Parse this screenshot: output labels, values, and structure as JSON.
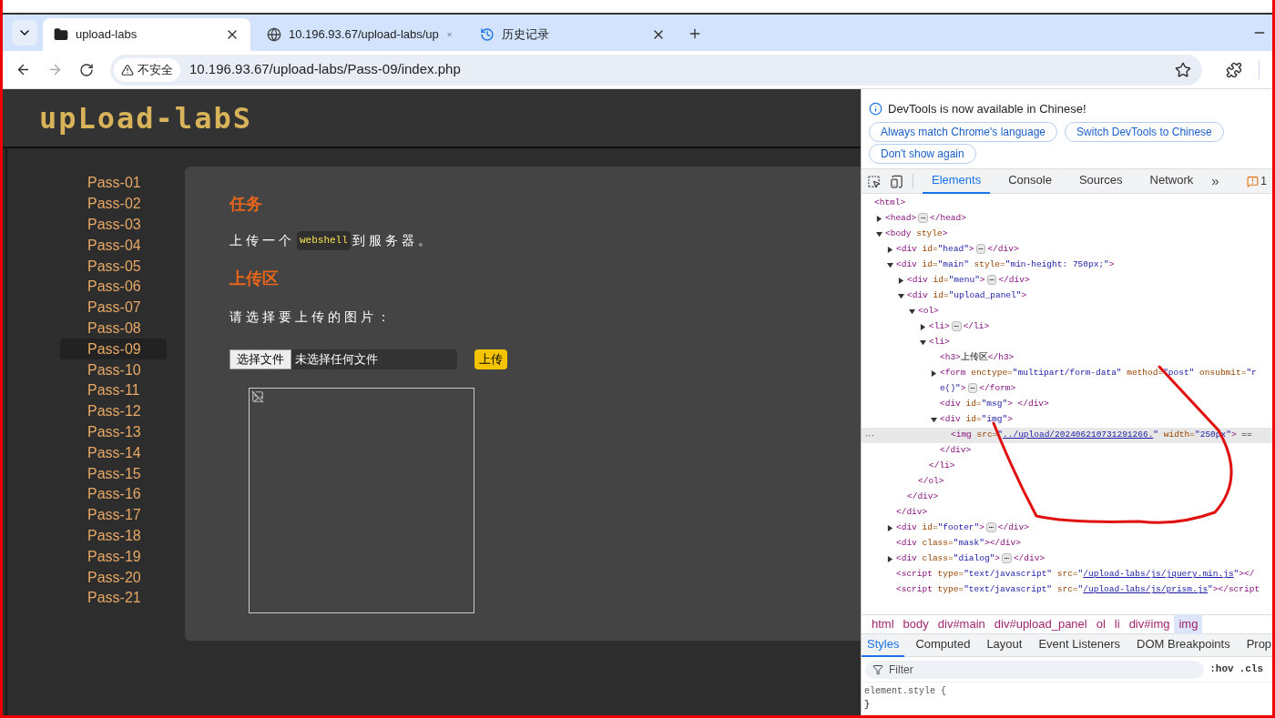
{
  "browser": {
    "tabs": [
      {
        "title": "upload-labs",
        "selected": true
      },
      {
        "title": "10.196.93.67/upload-labs/up",
        "selected": false
      },
      {
        "title": "历史记录",
        "selected": false
      }
    ],
    "security_label": "不安全",
    "url": "10.196.93.67/upload-labs/Pass-09/index.php"
  },
  "page": {
    "logo": "upLoad-labS",
    "menu": [
      {
        "label": "Pass-01",
        "selected": false
      },
      {
        "label": "Pass-02",
        "selected": false
      },
      {
        "label": "Pass-03",
        "selected": false
      },
      {
        "label": "Pass-04",
        "selected": false
      },
      {
        "label": "Pass-05",
        "selected": false
      },
      {
        "label": "Pass-06",
        "selected": false
      },
      {
        "label": "Pass-07",
        "selected": false
      },
      {
        "label": "Pass-08",
        "selected": false
      },
      {
        "label": "Pass-09",
        "selected": true
      },
      {
        "label": "Pass-10",
        "selected": false
      },
      {
        "label": "Pass-11",
        "selected": false
      },
      {
        "label": "Pass-12",
        "selected": false
      },
      {
        "label": "Pass-13",
        "selected": false
      },
      {
        "label": "Pass-14",
        "selected": false
      },
      {
        "label": "Pass-15",
        "selected": false
      },
      {
        "label": "Pass-16",
        "selected": false
      },
      {
        "label": "Pass-17",
        "selected": false
      },
      {
        "label": "Pass-18",
        "selected": false
      },
      {
        "label": "Pass-19",
        "selected": false
      },
      {
        "label": "Pass-20",
        "selected": false
      },
      {
        "label": "Pass-21",
        "selected": false
      }
    ],
    "task_heading": "任务",
    "task_text": [
      {
        "kind": "text",
        "text": "上传一个"
      },
      {
        "kind": "code",
        "text": "webshell"
      },
      {
        "kind": "text",
        "text": "到服务器。"
      }
    ],
    "upload_heading": "上传区",
    "prompt": "请选择要上传的图片：",
    "choose_button": "选择文件",
    "file_status": "未选择任何文件",
    "upload_button": "上传"
  },
  "devtools": {
    "notice": "DevTools is now available in Chinese!",
    "notice_buttons": [
      "Always match Chrome's language",
      "Switch DevTools to Chinese",
      "Don't show again"
    ],
    "tabs": [
      {
        "label": "Elements",
        "selected": true
      },
      {
        "label": "Console",
        "selected": false
      },
      {
        "label": "Sources",
        "selected": false
      },
      {
        "label": "Network",
        "selected": false
      }
    ],
    "more": "»",
    "issues_count": "1",
    "selected_line_marker": "···",
    "tree": [
      {
        "kind": "plain",
        "selected": false,
        "parts": [
          {
            "kind": "tag",
            "text": "<html>"
          }
        ],
        "children": [
          {
            "kind": "expandable",
            "expanded": false,
            "selected": false,
            "parts": [
              {
                "kind": "tag",
                "text": "<head>"
              },
              {
                "kind": "more",
                "text": "⋯"
              },
              {
                "kind": "tag",
                "text": "</head>"
              }
            ]
          },
          {
            "kind": "expandable",
            "expanded": true,
            "selected": false,
            "parts": [
              {
                "kind": "tag",
                "text": "<body"
              },
              {
                "kind": "attr",
                "text": " style"
              },
              {
                "kind": "tag",
                "text": ">"
              }
            ],
            "children": [
              {
                "kind": "expandable",
                "expanded": false,
                "selected": false,
                "parts": [
                  {
                    "kind": "tag",
                    "text": "<div"
                  },
                  {
                    "kind": "attr",
                    "text": " id="
                  },
                  {
                    "kind": "value",
                    "text": "\"head\""
                  },
                  {
                    "kind": "tag",
                    "text": ">"
                  },
                  {
                    "kind": "more",
                    "text": "⋯"
                  },
                  {
                    "kind": "tag",
                    "text": "</div>"
                  }
                ]
              },
              {
                "kind": "expandable",
                "expanded": true,
                "selected": false,
                "parts": [
                  {
                    "kind": "tag",
                    "text": "<div"
                  },
                  {
                    "kind": "attr",
                    "text": " id="
                  },
                  {
                    "kind": "value",
                    "text": "\"main\""
                  },
                  {
                    "kind": "attr",
                    "text": " style="
                  },
                  {
                    "kind": "value",
                    "text": "\"min-height: 750px;\""
                  },
                  {
                    "kind": "tag",
                    "text": ">"
                  }
                ],
                "closing": "</div>",
                "children": [
                  {
                    "kind": "expandable",
                    "expanded": false,
                    "selected": false,
                    "parts": [
                      {
                        "kind": "tag",
                        "text": "<div"
                      },
                      {
                        "kind": "attr",
                        "text": " id="
                      },
                      {
                        "kind": "value",
                        "text": "\"menu\""
                      },
                      {
                        "kind": "tag",
                        "text": ">"
                      },
                      {
                        "kind": "more",
                        "text": "⋯"
                      },
                      {
                        "kind": "tag",
                        "text": "</div>"
                      }
                    ]
                  },
                  {
                    "kind": "expandable",
                    "expanded": true,
                    "selected": false,
                    "parts": [
                      {
                        "kind": "tag",
                        "text": "<div"
                      },
                      {
                        "kind": "attr",
                        "text": " id="
                      },
                      {
                        "kind": "value",
                        "text": "\"upload_panel\""
                      },
                      {
                        "kind": "tag",
                        "text": ">"
                      }
                    ],
                    "closing": "</div>",
                    "children": [
                      {
                        "kind": "expandable",
                        "expanded": true,
                        "selected": false,
                        "parts": [
                          {
                            "kind": "tag",
                            "text": "<ol>"
                          }
                        ],
                        "closing": "</ol>",
                        "children": [
                          {
                            "kind": "expandable",
                            "expanded": false,
                            "selected": false,
                            "parts": [
                              {
                                "kind": "tag",
                                "text": "<li>"
                              },
                              {
                                "kind": "more",
                                "text": "⋯"
                              },
                              {
                                "kind": "tag",
                                "text": "</li>"
                              }
                            ]
                          },
                          {
                            "kind": "expandable",
                            "expanded": true,
                            "selected": false,
                            "parts": [
                              {
                                "kind": "tag",
                                "text": "<li>"
                              }
                            ],
                            "closing": "</li>",
                            "children": [
                              {
                                "kind": "plain",
                                "selected": false,
                                "parts": [
                                  {
                                    "kind": "tag",
                                    "text": "<h3>"
                                  },
                                  {
                                    "kind": "text",
                                    "text": "上传区"
                                  },
                                  {
                                    "kind": "tag",
                                    "text": "</h3>"
                                  }
                                ]
                              },
                              {
                                "kind": "expandable",
                                "expanded": false,
                                "selected": false,
                                "parts": [
                                  {
                                    "kind": "tag",
                                    "text": "<form"
                                  },
                                  {
                                    "kind": "attr",
                                    "text": " enctype="
                                  },
                                  {
                                    "kind": "value",
                                    "text": "\"multipart/form-data\""
                                  },
                                  {
                                    "kind": "attr",
                                    "text": " method="
                                  },
                                  {
                                    "kind": "value",
                                    "text": "\"post\""
                                  },
                                  {
                                    "kind": "attr",
                                    "text": " onsubmit="
                                  },
                                  {
                                    "kind": "value",
                                    "text": "\"r"
                                  }
                                ],
                                "wrap_parts": [
                                  {
                                    "kind": "value",
                                    "text": "e()\""
                                  },
                                  {
                                    "kind": "tag",
                                    "text": ">"
                                  },
                                  {
                                    "kind": "more",
                                    "text": "⋯"
                                  },
                                  {
                                    "kind": "tag",
                                    "text": "</form>"
                                  }
                                ]
                              },
                              {
                                "kind": "plain",
                                "selected": false,
                                "parts": [
                                  {
                                    "kind": "tag",
                                    "text": "<div"
                                  },
                                  {
                                    "kind": "attr",
                                    "text": " id="
                                  },
                                  {
                                    "kind": "value",
                                    "text": "\"msg\""
                                  },
                                  {
                                    "kind": "tag",
                                    "text": "> </div>"
                                  }
                                ]
                              },
                              {
                                "kind": "expandable",
                                "expanded": true,
                                "selected": false,
                                "parts": [
                                  {
                                    "kind": "tag",
                                    "text": "<div"
                                  },
                                  {
                                    "kind": "attr",
                                    "text": " id="
                                  },
                                  {
                                    "kind": "value",
                                    "text": "\"img\""
                                  },
                                  {
                                    "kind": "tag",
                                    "text": ">"
                                  }
                                ],
                                "closing": "</div>",
                                "children": [
                                  {
                                    "kind": "plain",
                                    "selected": true,
                                    "parts": [
                                      {
                                        "kind": "tag",
                                        "text": "<img"
                                      },
                                      {
                                        "kind": "attr",
                                        "text": " src="
                                      },
                                      {
                                        "kind": "value",
                                        "text": "\""
                                      },
                                      {
                                        "kind": "link",
                                        "text": "../upload/202406210731291266."
                                      },
                                      {
                                        "kind": "value",
                                        "text": "\""
                                      },
                                      {
                                        "kind": "attr",
                                        "text": " width="
                                      },
                                      {
                                        "kind": "value",
                                        "text": "\"250px\""
                                      },
                                      {
                                        "kind": "tag",
                                        "text": ">"
                                      },
                                      {
                                        "kind": "text",
                                        "text": " =="
                                      }
                                    ]
                                  }
                                ]
                              }
                            ]
                          }
                        ]
                      }
                    ]
                  }
                ]
              },
              {
                "kind": "expandable",
                "expanded": false,
                "selected": false,
                "parts": [
                  {
                    "kind": "tag",
                    "text": "<div"
                  },
                  {
                    "kind": "attr",
                    "text": " id="
                  },
                  {
                    "kind": "value",
                    "text": "\"footer\""
                  },
                  {
                    "kind": "tag",
                    "text": ">"
                  },
                  {
                    "kind": "more",
                    "text": "⋯"
                  },
                  {
                    "kind": "tag",
                    "text": "</div>"
                  }
                ]
              },
              {
                "kind": "plain",
                "selected": false,
                "parts": [
                  {
                    "kind": "tag",
                    "text": "<div"
                  },
                  {
                    "kind": "attr",
                    "text": " class="
                  },
                  {
                    "kind": "value",
                    "text": "\"mask\""
                  },
                  {
                    "kind": "tag",
                    "text": "></div>"
                  }
                ]
              },
              {
                "kind": "expandable",
                "expanded": false,
                "selected": false,
                "parts": [
                  {
                    "kind": "tag",
                    "text": "<div"
                  },
                  {
                    "kind": "attr",
                    "text": " class="
                  },
                  {
                    "kind": "value",
                    "text": "\"dialog\""
                  },
                  {
                    "kind": "tag",
                    "text": ">"
                  },
                  {
                    "kind": "more",
                    "text": "⋯"
                  },
                  {
                    "kind": "tag",
                    "text": "</div>"
                  }
                ]
              },
              {
                "kind": "plain",
                "selected": false,
                "parts": [
                  {
                    "kind": "tag",
                    "text": "<script"
                  },
                  {
                    "kind": "attr",
                    "text": " type="
                  },
                  {
                    "kind": "value",
                    "text": "\"text/javascript\""
                  },
                  {
                    "kind": "attr",
                    "text": " src="
                  },
                  {
                    "kind": "value",
                    "text": "\""
                  },
                  {
                    "kind": "link",
                    "text": "/upload-labs/js/jquery.min.js"
                  },
                  {
                    "kind": "value",
                    "text": "\""
                  },
                  {
                    "kind": "tag",
                    "text": "></"
                  }
                ]
              },
              {
                "kind": "plain",
                "selected": false,
                "parts": [
                  {
                    "kind": "tag",
                    "text": "<script"
                  },
                  {
                    "kind": "attr",
                    "text": " type="
                  },
                  {
                    "kind": "value",
                    "text": "\"text/javascript\""
                  },
                  {
                    "kind": "attr",
                    "text": " src="
                  },
                  {
                    "kind": "value",
                    "text": "\""
                  },
                  {
                    "kind": "link",
                    "text": "/upload-labs/js/prism.js"
                  },
                  {
                    "kind": "value",
                    "text": "\""
                  },
                  {
                    "kind": "tag",
                    "text": "></script"
                  }
                ]
              }
            ]
          }
        ]
      }
    ],
    "breadcrumbs": [
      {
        "label": "html",
        "selected": false
      },
      {
        "label": "body",
        "selected": false
      },
      {
        "label": "div#main",
        "selected": false
      },
      {
        "label": "div#upload_panel",
        "selected": false
      },
      {
        "label": "ol",
        "selected": false
      },
      {
        "label": "li",
        "selected": false
      },
      {
        "label": "div#img",
        "selected": false
      },
      {
        "label": "img",
        "selected": true
      }
    ],
    "side_tabs": [
      {
        "label": "Styles",
        "selected": true
      },
      {
        "label": "Computed",
        "selected": false
      },
      {
        "label": "Layout",
        "selected": false
      },
      {
        "label": "Event Listeners",
        "selected": false
      },
      {
        "label": "DOM Breakpoints",
        "selected": false
      },
      {
        "label": "Prop",
        "selected": false
      }
    ],
    "filter_placeholder": "Filter",
    "hov": ":hov",
    "cls": ".cls",
    "style_rule": "element.style {",
    "style_close": "}"
  }
}
